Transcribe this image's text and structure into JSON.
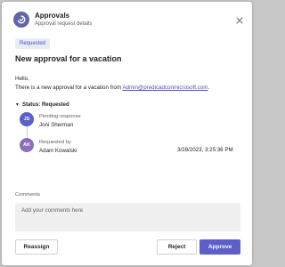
{
  "header": {
    "app_icon": "approvals-icon",
    "title": "Approvals",
    "subtitle": "Approval request details",
    "close_icon": "close-icon"
  },
  "status_badge": "Requested",
  "request": {
    "title": "New approval for a vacation",
    "greeting": "Hello,",
    "message_prefix": "There is a new approval for a vacation from ",
    "sender_email": "Admin@predicadconmicrosoft.com",
    "message_suffix": "."
  },
  "status_section": {
    "label": "Status: Requested",
    "chevron_icon": "chevron-down-icon",
    "entries": [
      {
        "initials": "JS",
        "label": "Pending response",
        "name": "Joni Sherman",
        "timestamp": ""
      },
      {
        "initials": "AK",
        "label": "Requested by",
        "name": "Adam Kowalski",
        "timestamp": "3/28/2023, 3:25:36 PM"
      }
    ]
  },
  "comments": {
    "label": "Comments",
    "placeholder": "Add your comments here"
  },
  "actions": {
    "reassign": "Reassign",
    "reject": "Reject",
    "approve": "Approve"
  },
  "colors": {
    "accent": "#5b5fc7",
    "badge_bg": "#e8ebfa",
    "avatar_js": "#5b5fc7",
    "avatar_ak": "#8b6fb8"
  }
}
